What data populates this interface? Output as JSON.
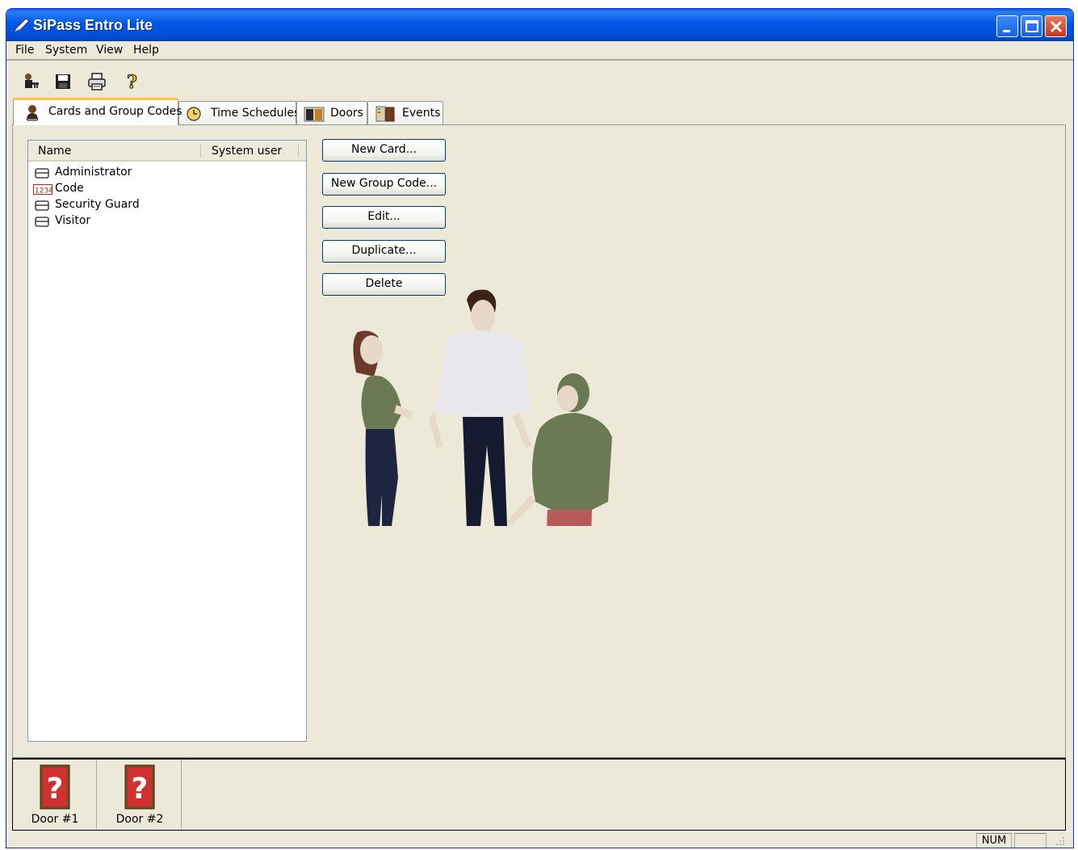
{
  "window": {
    "title": "SiPass Entro Lite"
  },
  "menu": {
    "items": [
      "File",
      "System",
      "View",
      "Help"
    ]
  },
  "toolbar": {
    "icons": [
      "user-key-icon",
      "save-icon",
      "print-icon",
      "help-icon"
    ]
  },
  "tabs": [
    {
      "label": "Cards and Group Codes",
      "icon": "person-card-icon",
      "active": true
    },
    {
      "label": "Time Schedules",
      "icon": "clock-icon",
      "active": false
    },
    {
      "label": "Doors",
      "icon": "door-icon",
      "active": false
    },
    {
      "label": "Events",
      "icon": "events-icon",
      "active": false
    }
  ],
  "list": {
    "columns": [
      "Name",
      "System user"
    ],
    "rows": [
      {
        "icon": "card-icon",
        "name": "Administrator"
      },
      {
        "icon": "code-icon",
        "code_badge": "1234",
        "name": "Code"
      },
      {
        "icon": "card-icon",
        "name": "Security Guard"
      },
      {
        "icon": "card-icon",
        "name": "Visitor"
      }
    ]
  },
  "buttons": {
    "new_card": "New Card...",
    "new_group_code": "New Group Code...",
    "edit": "Edit...",
    "duplicate": "Duplicate...",
    "delete": "Delete"
  },
  "doors": [
    {
      "label": "Door #1",
      "icon": "door-unknown-icon"
    },
    {
      "label": "Door #2",
      "icon": "door-unknown-icon"
    }
  ],
  "status": {
    "num": "NUM"
  },
  "colors": {
    "title_bar": "#0058e6",
    "face": "#ece9d8",
    "tab_highlight": "#ffc83c",
    "door_red": "#d03030"
  }
}
